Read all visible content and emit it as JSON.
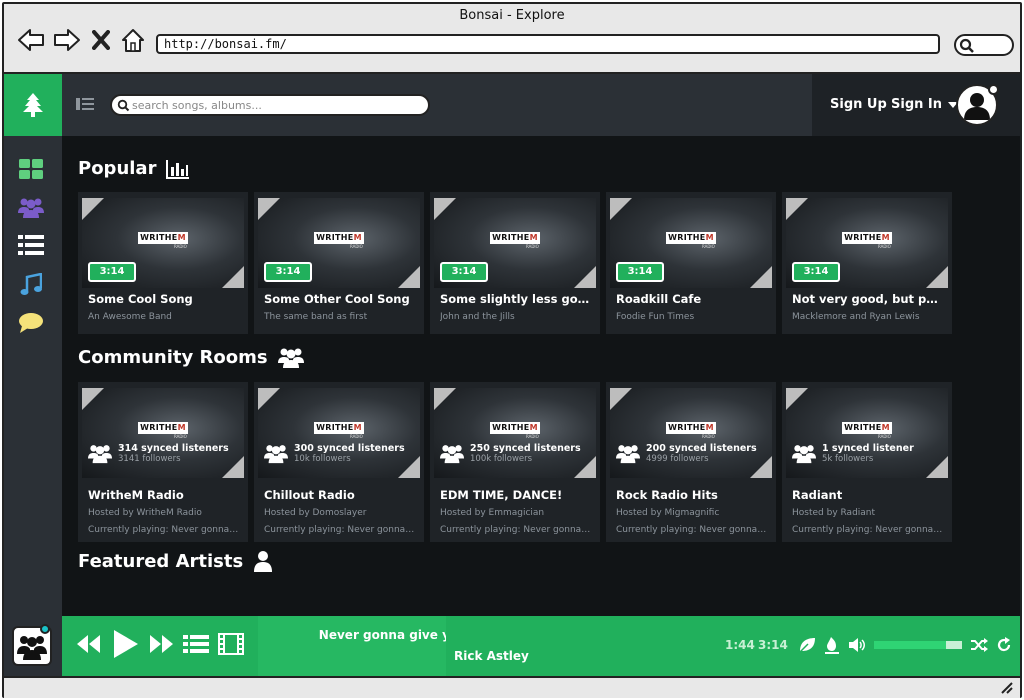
{
  "browser": {
    "title": "Bonsai - Explore",
    "url": "http://bonsai.fm/"
  },
  "header": {
    "search_placeholder": "search songs, albums...",
    "sign_up": "Sign Up",
    "sign_in": "Sign In"
  },
  "popular": {
    "title": "Popular",
    "items": [
      {
        "duration": "3:14",
        "title": "Some Cool Song",
        "artist": "An Awesome Band"
      },
      {
        "duration": "3:14",
        "title": "Some Other Cool Song",
        "artist": "The same band as first"
      },
      {
        "duration": "3:14",
        "title": "Some slightly less good so...",
        "artist": "John and the Jills"
      },
      {
        "duration": "3:14",
        "title": "Roadkill Cafe",
        "artist": "Foodie Fun Times"
      },
      {
        "duration": "3:14",
        "title": "Not very good, but popula...",
        "artist": "Macklemore and Ryan Lewis"
      }
    ]
  },
  "community": {
    "title": "Community Rooms",
    "items": [
      {
        "listeners": "314 synced listeners",
        "followers": "3141 followers",
        "title": "WritheM Radio",
        "host": "Hosted by WritheM Radio",
        "playing": "Currently playing: Never gonna g..."
      },
      {
        "listeners": "300 synced listeners",
        "followers": "10k followers",
        "title": "Chillout Radio",
        "host": "Hosted by Domoslayer",
        "playing": "Currently playing: Never gonna g..."
      },
      {
        "listeners": "250 synced listeners",
        "followers": "100k followers",
        "title": "EDM TIME, DANCE!",
        "host": "Hosted by Emmagician",
        "playing": "Currently playing: Never gonna g..."
      },
      {
        "listeners": "200 synced listeners",
        "followers": "4999 followers",
        "title": "Rock Radio Hits",
        "host": "Hosted by Migmagnific",
        "playing": "Currently playing: Never gonna g..."
      },
      {
        "listeners": "1 synced listener",
        "followers": "5k followers",
        "title": "Radiant",
        "host": "Hosted by Radiant",
        "playing": "Currently playing: Never gonna g..."
      }
    ]
  },
  "featured": {
    "title": "Featured Artists"
  },
  "thumbnail_brand": {
    "main": "WRITHE",
    "accent": "M",
    "sub": "RADIO"
  },
  "player": {
    "song": "Never gonna give you up",
    "artist": "Rick Astley",
    "time_current": "1:44",
    "time_total": "3:14",
    "volume": 0.82
  },
  "icons": {
    "sidebar": [
      "grid-icon",
      "users-icon",
      "list-icon",
      "music-note-icon",
      "chat-bubble-icon"
    ],
    "player": [
      "rewind-icon",
      "play-icon",
      "fast-forward-icon",
      "playlist-icon",
      "film-icon",
      "leaf-icon",
      "thumbs-down-icon",
      "volume-icon",
      "shuffle-icon",
      "repeat-icon"
    ]
  },
  "colors": {
    "accent_green": "#21b05c",
    "app_background": "#111416",
    "panel": "#2b3036",
    "card": "#1f2327",
    "sidebar_grid": "#5fcf7f",
    "sidebar_users": "#7b5cc9",
    "sidebar_music": "#4aa3df",
    "sidebar_chat": "#f5e27a"
  }
}
